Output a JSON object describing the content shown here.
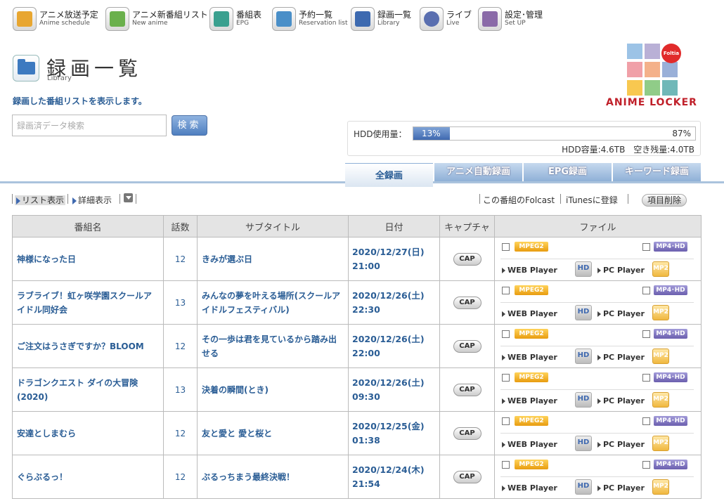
{
  "nav": [
    {
      "jp": "アニメ放送予定",
      "en": "Anime schedule",
      "icon": "anime-schedule-icon",
      "color": "#e8a630"
    },
    {
      "jp": "アニメ新番組リスト",
      "en": "New anime",
      "icon": "new-anime-icon",
      "color": "#6ab04c"
    },
    {
      "jp": "番組表",
      "en": "EPG",
      "icon": "epg-icon",
      "color": "#3aa08f"
    },
    {
      "jp": "予約一覧",
      "en": "Reservation list",
      "icon": "reservation-icon",
      "color": "#4a8fc8"
    },
    {
      "jp": "録画一覧",
      "en": "Library",
      "icon": "library-icon",
      "color": "#3d6ab0"
    },
    {
      "jp": "ライブ",
      "en": "Live",
      "icon": "live-icon",
      "color": "#5a6fb0"
    },
    {
      "jp": "設定･管理",
      "en": "Set UP",
      "icon": "settings-icon",
      "color": "#8a6aa8"
    }
  ],
  "page": {
    "title": "録画一覧",
    "title_en": "Library",
    "description": "録画した番組リストを表示します。"
  },
  "search": {
    "placeholder": "録画済データ検索",
    "button": "検索"
  },
  "logo": {
    "text": "ANIME LOCKER",
    "badge": "Foltia",
    "colors": [
      "#9cc3e6",
      "#b9b0d6",
      "#f0a0a8",
      "#f4b18a",
      "#f08a8a",
      "#9ab0d8",
      "#f8c850",
      "#90cc88",
      "#70b8b8"
    ]
  },
  "hdd": {
    "label": "HDD使用量：",
    "used_percent": 13,
    "used_text": "13%",
    "free_text": "87%",
    "capacity": "HDD容量:4.6TB　空き残量:4.0TB"
  },
  "tabs": [
    {
      "label": "全録画",
      "active": true
    },
    {
      "label": "アニメ自動録画",
      "active": false
    },
    {
      "label": "EPG録画",
      "active": false
    },
    {
      "label": "キーワード録画",
      "active": false
    }
  ],
  "toolbar": {
    "list_view": "リスト表示",
    "detail_view": "詳細表示",
    "folcast": "この番組のFolcast",
    "itunes": "iTunesに登録",
    "delete": "項目削除"
  },
  "table": {
    "headers": [
      "番組名",
      "話数",
      "サブタイトル",
      "日付",
      "キャプチャ",
      "ファイル"
    ],
    "labels": {
      "cap": "CAP",
      "mpeg2": "MPEG2",
      "mp4hd": "MP4･HD",
      "web_player": "WEB Player",
      "pc_player": "PC Player",
      "hd": "HD",
      "mp2": "MP2"
    },
    "rows": [
      {
        "name": "神様になった日",
        "ep": "12",
        "sub": "きみが選ぶ日",
        "date": "2020/12/27(日)",
        "time": "21:00"
      },
      {
        "name": "ラブライブ！虹ヶ咲学園スクールアイドル同好会",
        "ep": "13",
        "sub": "みんなの夢を叶える場所(スクールアイドルフェスティバル)",
        "date": "2020/12/26(土)",
        "time": "22:30"
      },
      {
        "name": "ご注文はうさぎですか？BLOOM",
        "ep": "12",
        "sub": "その一歩は君を見ているから踏み出せる",
        "date": "2020/12/26(土)",
        "time": "22:00"
      },
      {
        "name": "ドラゴンクエスト ダイの大冒険(2020)",
        "ep": "13",
        "sub": "決着の瞬間(とき)",
        "date": "2020/12/26(土)",
        "time": "09:30"
      },
      {
        "name": "安達としまむら",
        "ep": "12",
        "sub": "友と愛と 愛と桜と",
        "date": "2020/12/25(金)",
        "time": "01:38"
      },
      {
        "name": "ぐらぶるっ！",
        "ep": "12",
        "sub": "ぶるっちまう最終決戦！",
        "date": "2020/12/24(木)",
        "time": "21:54"
      }
    ]
  }
}
